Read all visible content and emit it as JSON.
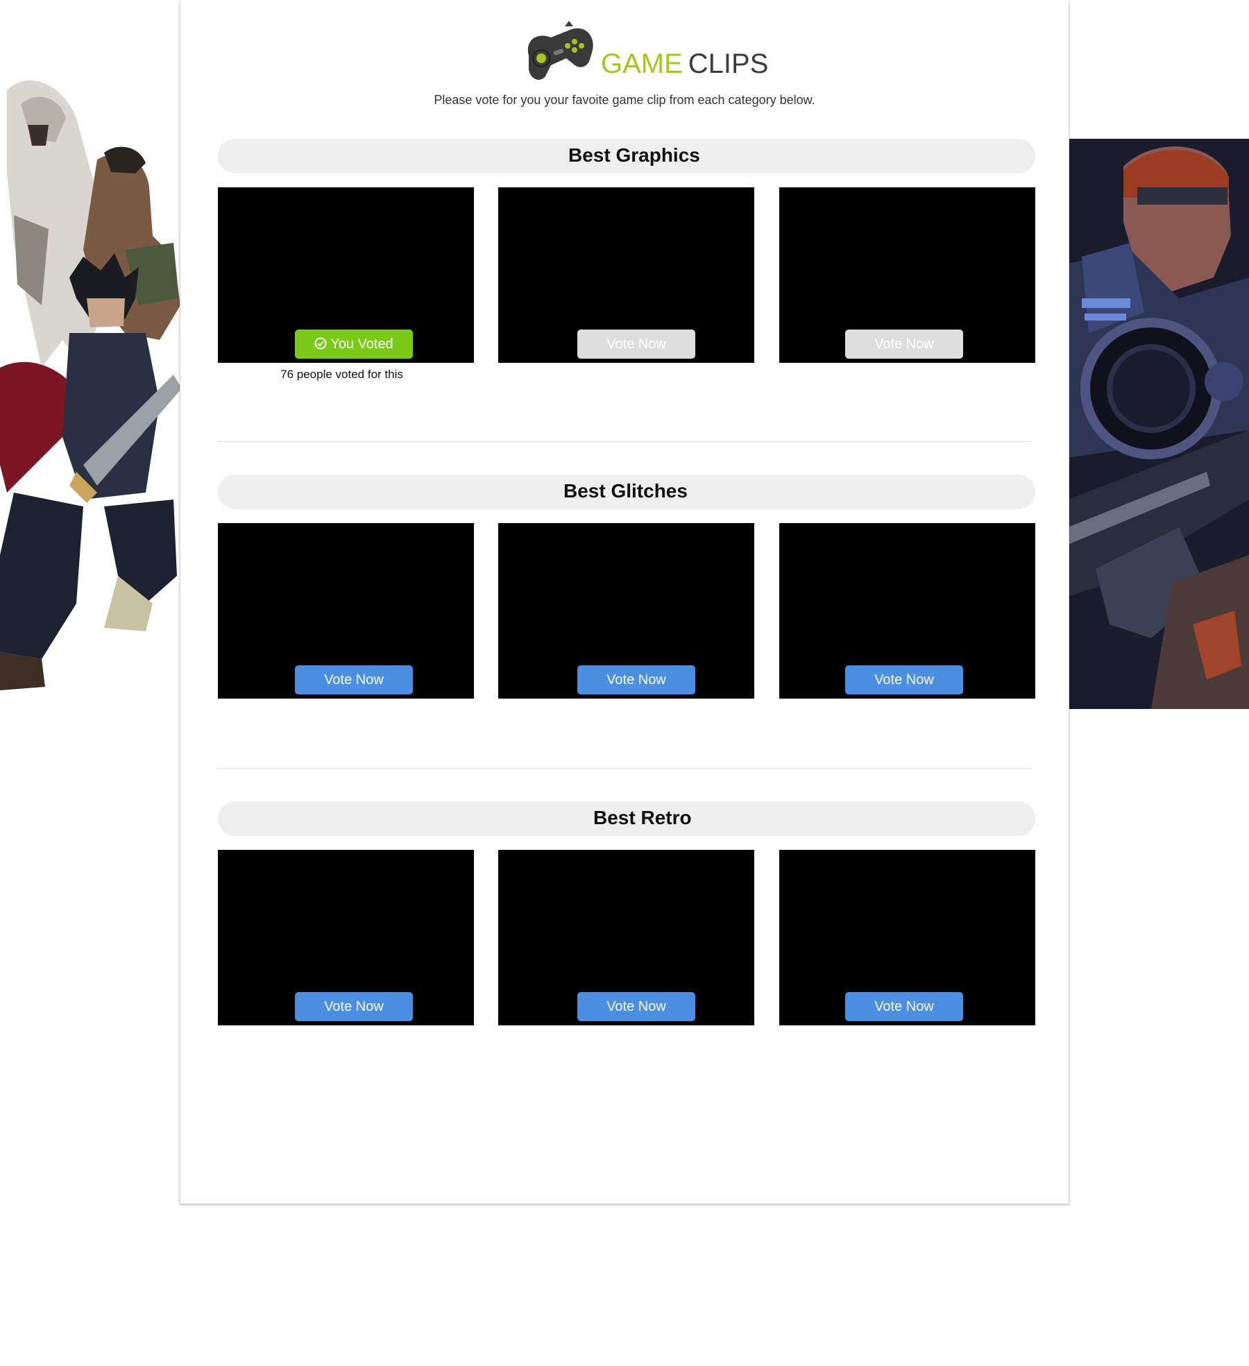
{
  "brand": {
    "word_1": "GAME",
    "word_2": "CLIPS",
    "icon": "gamepad-icon",
    "colors": {
      "game": "#a6c517",
      "clips": "#3c3c3c"
    }
  },
  "intro_text": "Please vote for you your favoite game clip from each category below.",
  "colors": {
    "vote_button": "#4a8fe2",
    "voted_button": "#7acb18",
    "disabled_button": "#dedede",
    "category_bar": "#eeeeee"
  },
  "categories": [
    {
      "title": "Best Graphics",
      "clips": [
        {
          "button_label": "You Voted",
          "state": "voted",
          "vote_count_text": "76 people voted for this"
        },
        {
          "button_label": "Vote Now",
          "state": "disabled"
        },
        {
          "button_label": "Vote Now",
          "state": "disabled"
        }
      ]
    },
    {
      "title": "Best Glitches",
      "clips": [
        {
          "button_label": "Vote Now",
          "state": "active"
        },
        {
          "button_label": "Vote Now",
          "state": "active"
        },
        {
          "button_label": "Vote Now",
          "state": "active"
        }
      ]
    },
    {
      "title": "Best Retro",
      "clips": [
        {
          "button_label": "Vote Now",
          "state": "active"
        },
        {
          "button_label": "Vote Now",
          "state": "active"
        },
        {
          "button_label": "Vote Now",
          "state": "active"
        }
      ]
    }
  ],
  "decor": {
    "left_art": "game-characters-left-art",
    "right_art": "armored-soldier-right-art"
  }
}
